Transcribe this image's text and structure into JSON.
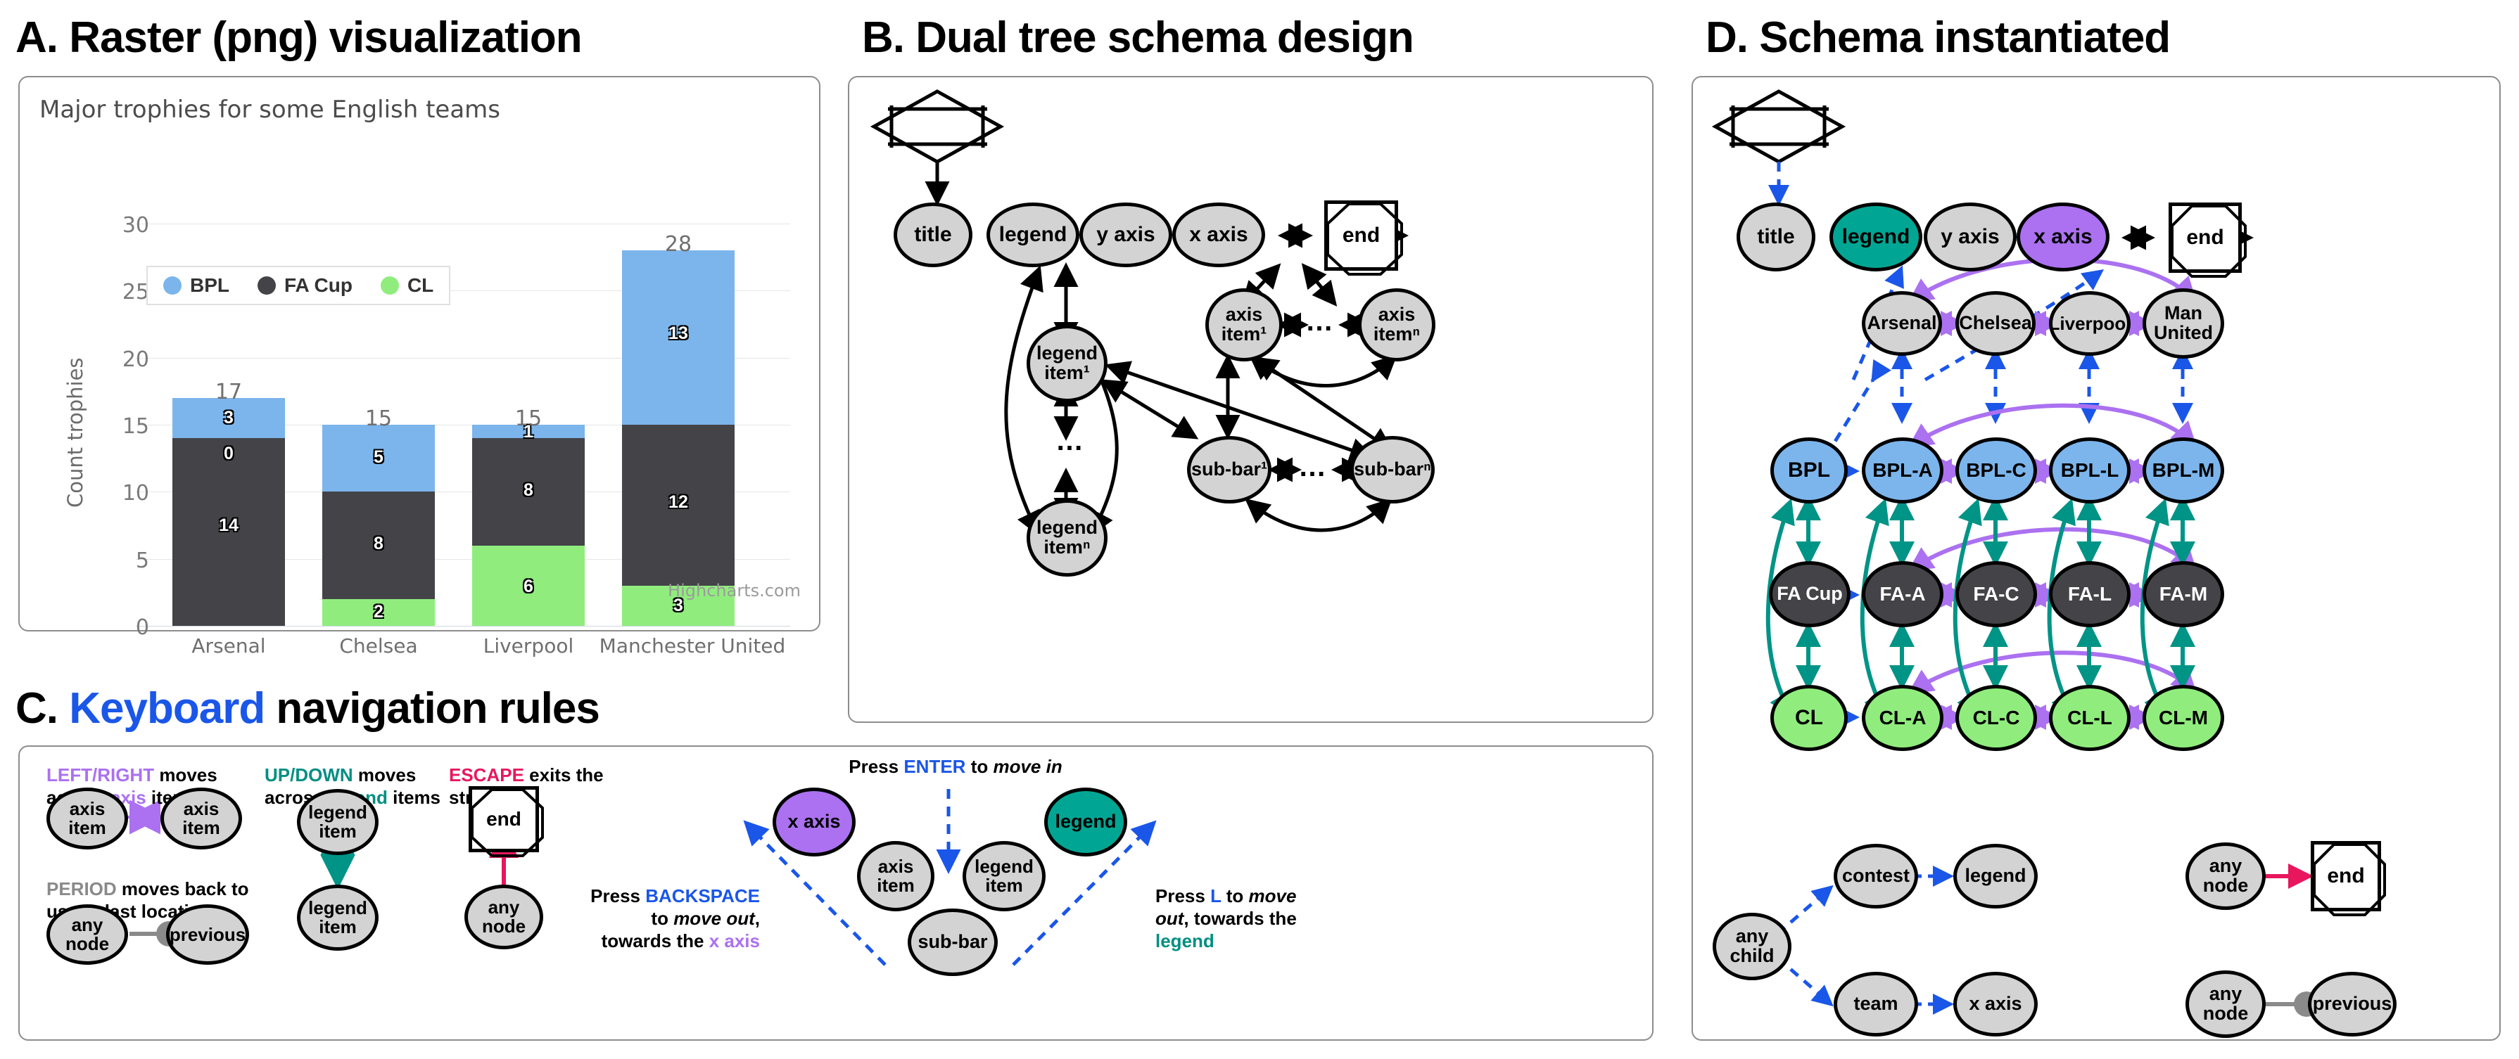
{
  "panels": {
    "a": {
      "label": "A. Raster (png) visualization"
    },
    "b": {
      "label": "B. Dual tree schema design"
    },
    "c": {
      "prefix": "C. ",
      "keyword": "Keyboard",
      "suffix": " navigation rules"
    },
    "d": {
      "label": "D. Schema instantiated"
    }
  },
  "chart_data": {
    "type": "bar",
    "stacked": true,
    "title": "Major trophies for some English teams",
    "xlabel": "",
    "ylabel": "Count trophies",
    "ylim": [
      0,
      30
    ],
    "yticks": [
      0,
      5,
      10,
      15,
      20,
      25,
      30
    ],
    "grid": true,
    "legend_position": "top-left-inside",
    "credit": "Highcharts.com",
    "categories": [
      "Arsenal",
      "Chelsea",
      "Liverpool",
      "Manchester United"
    ],
    "totals": [
      17,
      15,
      15,
      28
    ],
    "series": [
      {
        "name": "CL",
        "color": "#90ed7d",
        "values": [
          0,
          2,
          6,
          3
        ]
      },
      {
        "name": "FA Cup",
        "color": "#434348",
        "values": [
          14,
          8,
          8,
          12
        ]
      },
      {
        "name": "BPL",
        "color": "#7cb5ec",
        "values": [
          3,
          5,
          1,
          13
        ]
      }
    ],
    "legend_order": [
      "BPL",
      "FA Cup",
      "CL"
    ]
  },
  "schema": {
    "start": "start",
    "end": "end",
    "top_row": [
      "title",
      "legend",
      "y axis",
      "x axis"
    ],
    "axis_item_1": "axis\nitem¹",
    "axis_item_n": "axis\nitemⁿ",
    "legend_item_1": "legend\nitem¹",
    "legend_item_n": "legend\nitemⁿ",
    "sub_bar_1": "sub-bar¹",
    "sub_bar_n": "sub-barⁿ",
    "ellipsis": "…"
  },
  "rules": {
    "r1": {
      "key": "LEFT/RIGHT",
      "rest1": " moves",
      "rest2": "across ",
      "target": "axis",
      "rest3": " items",
      "node_a": "axis\nitem",
      "node_b": "axis\nitem"
    },
    "r2": {
      "key": "PERIOD",
      "rest1": " moves back to",
      "rest2": "user's last location",
      "node_a": "any\nnode",
      "node_b": "previous"
    },
    "r3": {
      "key": "UP/DOWN",
      "rest1": " moves",
      "rest2": "across ",
      "target": "legend",
      "rest3": " items",
      "node_a": "legend\nitem",
      "node_b": "legend\nitem"
    },
    "r4": {
      "key": "ESCAPE",
      "rest1": " exits the",
      "rest2": "structure",
      "node_end": "end",
      "node_a": "any\nnode"
    },
    "enter": {
      "pre": "Press ",
      "key": "ENTER",
      "post": " to ",
      "em": "move in"
    },
    "backspace": {
      "l1pre": "Press ",
      "l1key": "BACKSPACE",
      "l2pre": "to ",
      "l2em": "move out",
      "l2post": ",",
      "l3pre": "towards the ",
      "l3target": "x axis"
    },
    "lkey": {
      "l1pre": "Press ",
      "l1key": "L",
      "l1post": " to ",
      "l1em": "move",
      "l2em": "out",
      "l2post": ", towards the",
      "l3target": "legend"
    },
    "center_nodes": {
      "x_axis": "x axis",
      "legend": "legend",
      "axis_item": "axis\nitem",
      "legend_item": "legend\nitem",
      "sub_bar": "sub-bar"
    }
  },
  "instance": {
    "start": "start",
    "end": "end",
    "top_row": [
      "title",
      "legend",
      "y axis",
      "x axis"
    ],
    "teams": [
      "Arsenal",
      "Chelsea",
      "Liverpool",
      "Man\nUnited"
    ],
    "rows": [
      {
        "root": "BPL",
        "cells": [
          "BPL-A",
          "BPL-C",
          "BPL-L",
          "BPL-M"
        ],
        "color": "#7cb5ec"
      },
      {
        "root": "FA Cup",
        "cells": [
          "FA-A",
          "FA-C",
          "FA-L",
          "FA-M"
        ],
        "color": "#434348"
      },
      {
        "root": "CL",
        "cells": [
          "CL-A",
          "CL-C",
          "CL-L",
          "CL-M"
        ],
        "color": "#90ed7d"
      }
    ],
    "legend_flow": {
      "any_child": "any\nchild",
      "contest": "contest",
      "legend": "legend",
      "team": "team",
      "x_axis": "x axis"
    },
    "exit_flow": {
      "any_node_1": "any\nnode",
      "end": "end",
      "any_node_2": "any\nnode",
      "previous": "previous"
    }
  },
  "colors": {
    "bpl": "#7cb5ec",
    "facup": "#434348",
    "cl": "#90ed7d",
    "teal": "#00a693",
    "purple": "#ab71f0",
    "blue": "#1a56e8",
    "pink": "#e8175d",
    "grey_node": "#d3d3d3"
  }
}
